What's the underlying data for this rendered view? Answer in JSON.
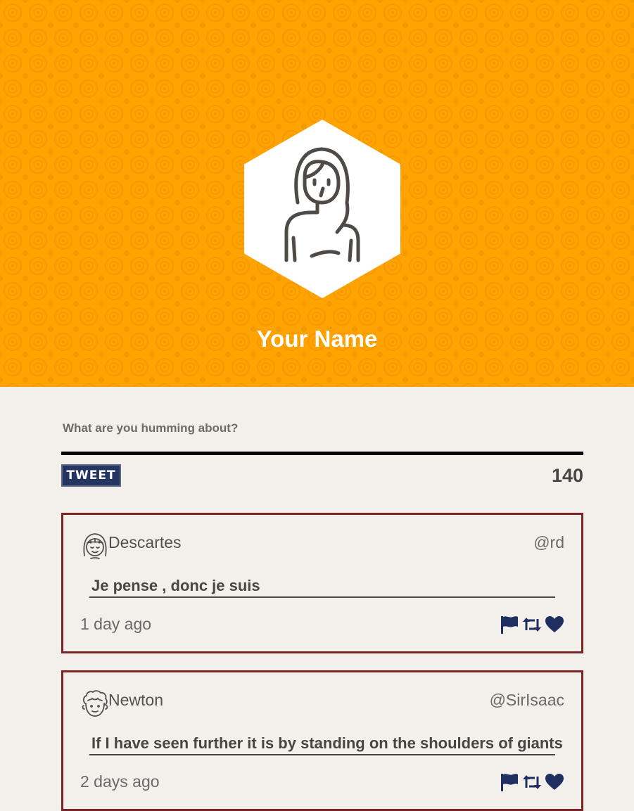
{
  "profile": {
    "name": "Your Name",
    "avatar_icon": "woman-avatar-icon",
    "header_color": "#fea301"
  },
  "compose": {
    "label": "What are you humming about?",
    "input_value": "",
    "tweet_label": "TWEET",
    "char_count": "140"
  },
  "tweets": [
    {
      "name": "Descartes",
      "handle": "@rd",
      "text": "Je pense , donc je suis",
      "time": "1 day ago",
      "avatar_icon": "girl-avatar-icon"
    },
    {
      "name": "Newton",
      "handle": "@SirIsaac",
      "text": "If I have seen further it is by standing on the shoulders of giants",
      "time": "2 days ago",
      "avatar_icon": "curly-hair-avatar-icon"
    }
  ],
  "actions": {
    "flag_icon": "flag-icon",
    "retweet_icon": "retweet-icon",
    "like_icon": "heart-icon"
  },
  "colors": {
    "accent_navy": "#1f2f5f",
    "card_border": "#7a2425",
    "page_background": "#f3f0ec"
  }
}
